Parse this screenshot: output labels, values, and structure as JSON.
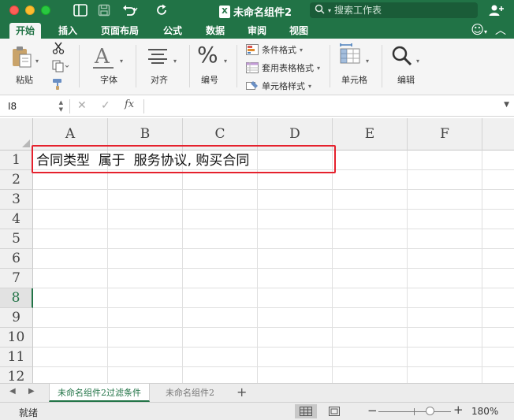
{
  "title_bar": {
    "doc_title": "未命名组件2",
    "file_badge": "X",
    "search_placeholder": "搜索工作表"
  },
  "ribbon_tabs": [
    "开始",
    "插入",
    "页面布局",
    "公式",
    "数据",
    "审阅",
    "视图"
  ],
  "active_tab": "开始",
  "ribbon": {
    "paste": "粘贴",
    "font": "字体",
    "alignment": "对齐",
    "number": "编号",
    "number_symbol": "%",
    "font_symbol": "A",
    "conditional_format": "条件格式",
    "table_format": "套用表格格式",
    "cell_styles": "单元格样式",
    "cells": "单元格",
    "editing": "编辑"
  },
  "formula_bar": {
    "name_box": "I8",
    "formula": "",
    "fx": "fx"
  },
  "sheet": {
    "columns": [
      "A",
      "B",
      "C",
      "D",
      "E",
      "F"
    ],
    "rows": [
      "1",
      "2",
      "3",
      "4",
      "5",
      "6",
      "7",
      "8",
      "9",
      "10",
      "11",
      "12"
    ],
    "selected_row": "8",
    "cell_A1": "合同类型  属于  服务协议, 购买合同"
  },
  "sheet_tabs": [
    "未命名组件2过滤条件",
    "未命名组件2"
  ],
  "active_sheet": "未命名组件2过滤条件",
  "add_sheet": "+",
  "status_bar": {
    "status": "就绪",
    "zoom_minus": "−",
    "zoom_plus": "+",
    "zoom": "180%",
    "zoom_value_percent": 180
  },
  "colors": {
    "brand_green": "#217346",
    "highlight_red": "#e5212d"
  }
}
